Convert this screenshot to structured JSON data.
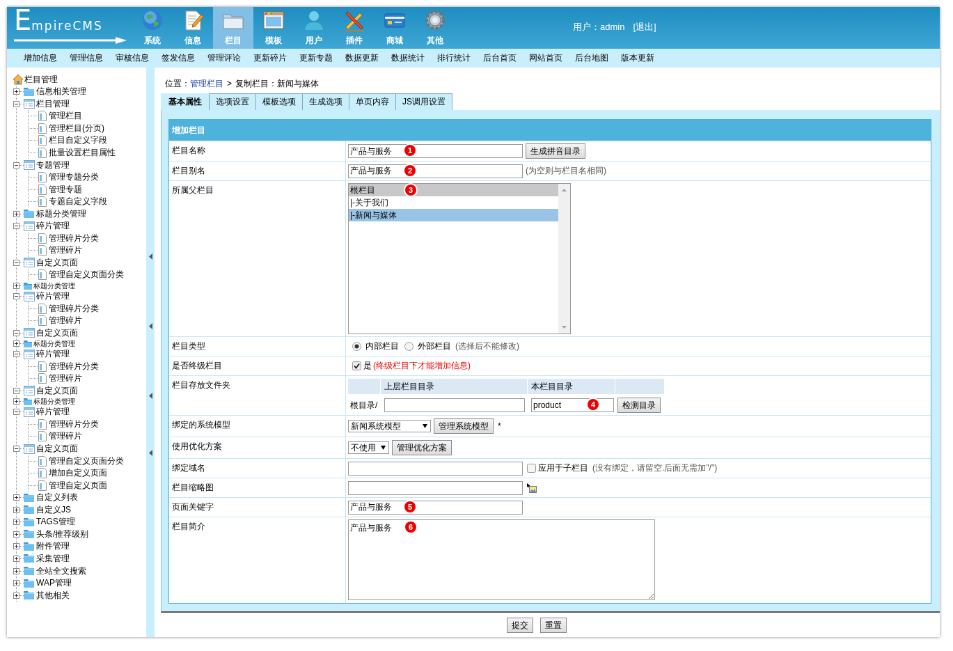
{
  "header": {
    "logo": "EmpireCMS",
    "nav": [
      {
        "label": "系统",
        "selected": false
      },
      {
        "label": "信息",
        "selected": false
      },
      {
        "label": "栏目",
        "selected": true
      },
      {
        "label": "模板",
        "selected": false
      },
      {
        "label": "用户",
        "selected": false
      },
      {
        "label": "插件",
        "selected": false
      },
      {
        "label": "商城",
        "selected": false
      },
      {
        "label": "其他",
        "selected": false
      }
    ],
    "user": "用户：admin",
    "logout": "[退出]"
  },
  "menu": [
    "增加信息",
    "管理信息",
    "审核信息",
    "签发信息",
    "管理评论",
    "更新碎片",
    "更新专题",
    "数据更新",
    "数据统计",
    "排行统计",
    "后台首页",
    "网站首页",
    "后台地图",
    "版本更新"
  ],
  "sidebar": {
    "title": "栏目管理",
    "items": [
      {
        "label": "信息相关管理",
        "kind": "folder",
        "expanded": false
      },
      {
        "label": "栏目管理",
        "kind": "folder",
        "expanded": true,
        "children": [
          {
            "label": "管理栏目",
            "kind": "page"
          },
          {
            "label": "管理栏目(分页)",
            "kind": "page"
          },
          {
            "label": "栏目自定义字段",
            "kind": "page"
          },
          {
            "label": "批量设置栏目属性",
            "kind": "page"
          }
        ]
      },
      {
        "label": "专题管理",
        "kind": "folder",
        "expanded": true,
        "children": [
          {
            "label": "管理专题分类",
            "kind": "page"
          },
          {
            "label": "管理专题",
            "kind": "page"
          },
          {
            "label": "专题自定义字段",
            "kind": "page"
          }
        ]
      },
      {
        "label": "标题分类管理",
        "kind": "folder",
        "expanded": false
      },
      {
        "label": "碎片管理",
        "kind": "folder",
        "expanded": true,
        "children": [
          {
            "label": "管理碎片分类",
            "kind": "page"
          },
          {
            "label": "管理碎片",
            "kind": "page"
          }
        ]
      },
      {
        "label": "自定义页面",
        "kind": "folder",
        "expanded": true,
        "children": [
          {
            "label": "管理自定义页面分类",
            "kind": "page"
          }
        ]
      },
      {
        "label": "标题分类管理",
        "kind": "clipped"
      },
      {
        "label": "碎片管理",
        "kind": "folder",
        "expanded": true,
        "children": [
          {
            "label": "管理碎片分类",
            "kind": "page"
          },
          {
            "label": "管理碎片",
            "kind": "page"
          }
        ]
      },
      {
        "label": "自定义页面",
        "kind": "folder",
        "expanded": true
      },
      {
        "label": "标题分类管理",
        "kind": "clipped"
      },
      {
        "label": "碎片管理",
        "kind": "folder",
        "expanded": true,
        "children": [
          {
            "label": "管理碎片分类",
            "kind": "page"
          },
          {
            "label": "管理碎片",
            "kind": "page"
          }
        ]
      },
      {
        "label": "自定义页面",
        "kind": "folder",
        "expanded": true
      },
      {
        "label": "标题分类管理",
        "kind": "clipped"
      },
      {
        "label": "碎片管理",
        "kind": "folder",
        "expanded": true,
        "children": [
          {
            "label": "管理碎片分类",
            "kind": "page"
          },
          {
            "label": "管理碎片",
            "kind": "page"
          }
        ]
      },
      {
        "label": "自定义页面",
        "kind": "folder",
        "expanded": true,
        "children": [
          {
            "label": "管理自定义页面分类",
            "kind": "page"
          },
          {
            "label": "增加自定义页面",
            "kind": "page"
          },
          {
            "label": "管理自定义页面",
            "kind": "page"
          }
        ]
      },
      {
        "label": "自定义列表",
        "kind": "folder",
        "expanded": false
      },
      {
        "label": "自定义JS",
        "kind": "folder",
        "expanded": false
      },
      {
        "label": "TAGS管理",
        "kind": "folder",
        "expanded": false
      },
      {
        "label": "头条/推荐级别",
        "kind": "folder",
        "expanded": false
      },
      {
        "label": "附件管理",
        "kind": "folder",
        "expanded": false
      },
      {
        "label": "采集管理",
        "kind": "folder",
        "expanded": false
      },
      {
        "label": "全站全文搜索",
        "kind": "folder",
        "expanded": false
      },
      {
        "label": "WAP管理",
        "kind": "folder",
        "expanded": false
      },
      {
        "label": "其他相关",
        "kind": "folder",
        "expanded": false
      }
    ]
  },
  "breadcrumb": {
    "prefix": "位置：",
    "link": "管理栏目",
    "separator": ">",
    "current": "复制栏目：新闻与媒体"
  },
  "tabs": [
    {
      "label": "基本属性",
      "selected": true
    },
    {
      "label": "选项设置",
      "selected": false
    },
    {
      "label": "模板选项",
      "selected": false
    },
    {
      "label": "生成选项",
      "selected": false
    },
    {
      "label": "单页内容",
      "selected": false
    },
    {
      "label": "JS调用设置",
      "selected": false
    }
  ],
  "form": {
    "title": "增加栏目",
    "rows": [
      {
        "kind": "text",
        "label": "栏目名称",
        "value": "产品与服务",
        "marker": "1",
        "button": "生成拼音目录"
      },
      {
        "kind": "text",
        "label": "栏目别名",
        "value": "产品与服务",
        "marker": "2",
        "note": "(为空则与栏目名相同)"
      },
      {
        "kind": "listbox",
        "label": "所属父栏目",
        "marker": "3",
        "options": [
          {
            "label": "根栏目",
            "kind": "root",
            "selected": false
          },
          {
            "label": "|-关于我们",
            "kind": "child",
            "selected": false
          },
          {
            "label": "|-新闻与媒体",
            "kind": "child",
            "selected": true
          }
        ]
      },
      {
        "kind": "radio",
        "label": "栏目类型",
        "options": [
          {
            "label": "内部栏目",
            "selected": true
          },
          {
            "label": "外部栏目",
            "selected": false
          }
        ],
        "note": "(选择后不能修改)"
      },
      {
        "kind": "checkbox",
        "label": "是否终级栏目",
        "checked": true,
        "text": "是",
        "warning": "(终级栏目下才能增加信息)"
      },
      {
        "kind": "folder",
        "label": "栏目存放文件夹",
        "columns": [
          "上层栏目目录",
          "本栏目目录"
        ],
        "prefix": "根目录/",
        "value": "product",
        "marker": "4",
        "button": "检测目录"
      },
      {
        "kind": "select",
        "label": "绑定的系统模型",
        "value": "新闻系统模型",
        "button": "管理系统模型",
        "suffix": "*"
      },
      {
        "kind": "select",
        "label": "使用优化方案",
        "value": "不使用",
        "button": "管理优化方案"
      },
      {
        "kind": "text",
        "label": "绑定域名",
        "option": {
          "checked": false,
          "label": "应用于子栏目",
          "note": "(没有绑定，请留空.后面无需加\"/\")"
        }
      },
      {
        "kind": "image",
        "label": "栏目缩略图"
      },
      {
        "kind": "text",
        "label": "页面关键字",
        "value": "产品与服务",
        "marker": "5"
      },
      {
        "kind": "textarea",
        "label": "栏目简介",
        "value": "产品与服务",
        "marker": "6"
      }
    ]
  },
  "buttons": [
    "提交",
    "重置"
  ]
}
